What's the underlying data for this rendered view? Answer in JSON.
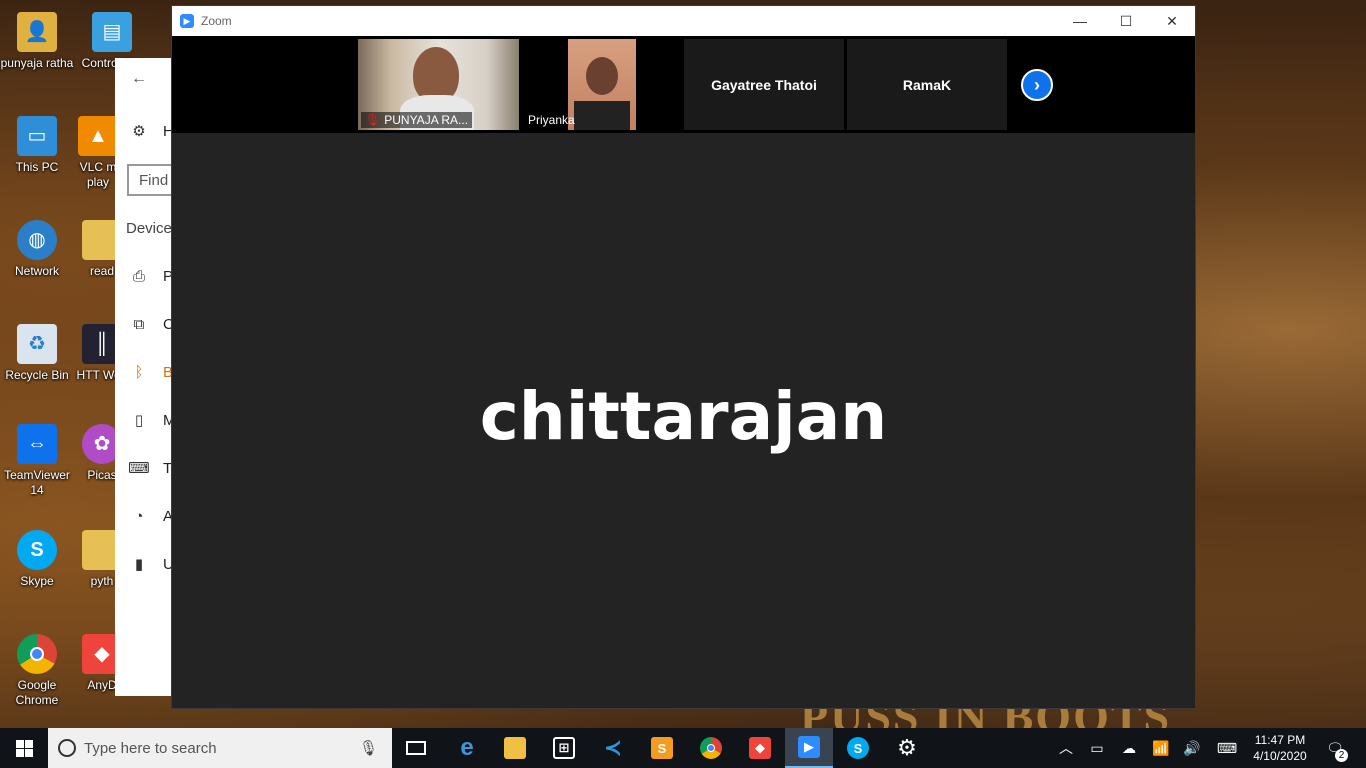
{
  "desktop": {
    "icons": [
      {
        "label": "punyaja ratha",
        "icon": "user-folder-icon"
      },
      {
        "label": "Control Par",
        "icon": "control-panel-icon"
      },
      {
        "label": "This PC",
        "icon": "computer-icon"
      },
      {
        "label": "VLC m play",
        "icon": "vlc-icon"
      },
      {
        "label": "Network",
        "icon": "network-icon"
      },
      {
        "label": "read",
        "icon": "folder-icon"
      },
      {
        "label": "Recycle Bin",
        "icon": "recycle-bin-icon"
      },
      {
        "label": "HTT Web",
        "icon": "httrack-icon"
      },
      {
        "label": "TeamViewer 14",
        "icon": "teamviewer-icon"
      },
      {
        "label": "Picas",
        "icon": "picasa-icon"
      },
      {
        "label": "Skype",
        "icon": "skype-icon"
      },
      {
        "label": "pyth",
        "icon": "python-folder-icon"
      },
      {
        "label": "Google Chrome",
        "icon": "chrome-icon"
      },
      {
        "label": "AnyD",
        "icon": "anydesk-icon"
      }
    ],
    "wallpaper_text": "PUSS IN BOOTS"
  },
  "settings": {
    "home_label": "H",
    "find_placeholder": "Find",
    "section_label": "Device",
    "items": [
      "P",
      "C",
      "B",
      "M",
      "T",
      "A",
      "U"
    ]
  },
  "zoom": {
    "title": "Zoom",
    "participants": [
      {
        "name": "PUNYAJA RA...",
        "muted": true
      },
      {
        "name": "Priyanka",
        "muted": false
      },
      {
        "name": "Gayatree Thatoi"
      },
      {
        "name": "RamaK"
      }
    ],
    "active_speaker": "chittarajan"
  },
  "taskbar": {
    "search_placeholder": "Type here to search",
    "apps": [
      "task-view",
      "edge",
      "file-explorer",
      "store",
      "vscode",
      "sublime-text",
      "chrome",
      "anydesk",
      "zoom",
      "skype",
      "settings"
    ],
    "clock_time": "11:47 PM",
    "clock_date": "4/10/2020",
    "notification_count": "2"
  },
  "colors": {
    "zoom_blue": "#2d8cff",
    "taskbar": "#101418",
    "zoom_bg": "#232323"
  }
}
